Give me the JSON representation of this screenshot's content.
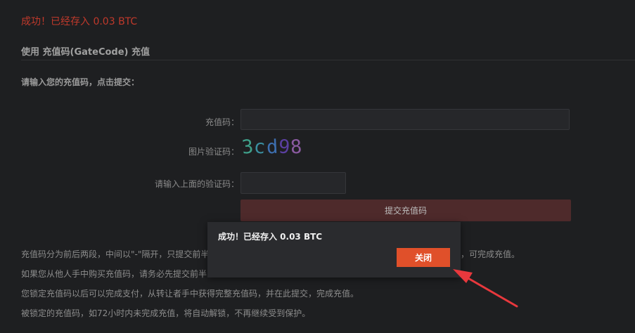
{
  "status": {
    "success_message": "成功！已经存入 0.03 BTC"
  },
  "section": {
    "title": "使用 充值码(GateCode) 充值",
    "prompt": "请输入您的充值码，点击提交："
  },
  "form": {
    "code_label": "充值码：",
    "code_value": "",
    "captcha_label": "图片验证码：",
    "captcha_chars": [
      {
        "ch": "3",
        "color": "#3fa08a"
      },
      {
        "ch": "c",
        "color": "#3a8fa0"
      },
      {
        "ch": "d",
        "color": "#3d6fb0"
      },
      {
        "ch": "9",
        "color": "#5a3fa0"
      },
      {
        "ch": "8",
        "color": "#8a5aa0"
      }
    ],
    "verify_label": "请输入上面的验证码：",
    "verify_value": "",
    "submit_label": "提交充值码"
  },
  "info": {
    "line1": "充值码分为前后两段，中间以\"-\"隔开，只提交前半",
    "line1_tail": "，可完成充值。",
    "line2": "如果您从他人手中购买充值码，请务必先提交前半",
    "line3": "您锁定充值码以后可以完成支付，从转让者手中获得完整充值码，并在此提交，完成充值。",
    "line4": "被锁定的充值码，如72小时内未完成充值，将自动解锁，不再继续受到保护。"
  },
  "modal": {
    "message": "成功！已经存入 0.03 BTC",
    "close_label": "关闭"
  },
  "colors": {
    "accent": "#e0502a",
    "error": "#c0392b",
    "annotation_arrow": "#e8383d"
  }
}
